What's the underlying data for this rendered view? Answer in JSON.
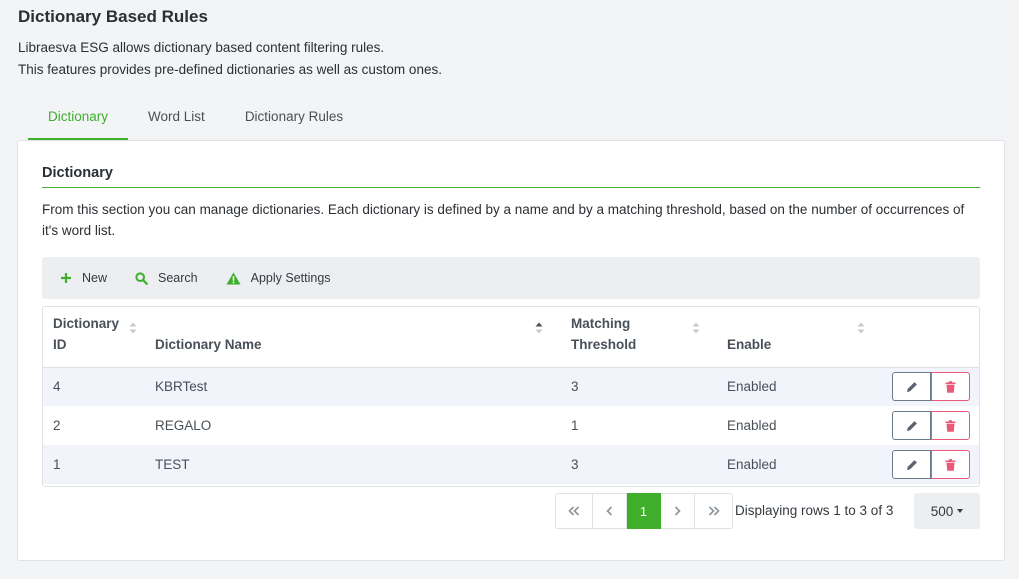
{
  "page": {
    "title": "Dictionary Based Rules",
    "description_line1": "Libraesva ESG allows dictionary based content filtering rules.",
    "description_line2": "This features provides pre-defined dictionaries as well as custom ones."
  },
  "tabs": [
    {
      "label": "Dictionary",
      "active": true
    },
    {
      "label": "Word List",
      "active": false
    },
    {
      "label": "Dictionary Rules",
      "active": false
    }
  ],
  "card": {
    "title": "Dictionary",
    "description": "From this section you can manage dictionaries. Each dictionary is defined by a name and by a matching threshold, based on the number of occurrences of it's word list."
  },
  "toolbar": {
    "new_label": "New",
    "search_label": "Search",
    "apply_label": "Apply Settings"
  },
  "table": {
    "columns": {
      "id_line1": "Dictionary",
      "id_line2": "ID",
      "name": "Dictionary Name",
      "threshold_line1": "Matching",
      "threshold_line2": "Threshold",
      "enable": "Enable"
    },
    "rows": [
      {
        "id": "4",
        "name": "KBRTest",
        "threshold": "3",
        "enable": "Enabled"
      },
      {
        "id": "2",
        "name": "REGALO",
        "threshold": "1",
        "enable": "Enabled"
      },
      {
        "id": "1",
        "name": "TEST",
        "threshold": "3",
        "enable": "Enabled"
      }
    ]
  },
  "pagination": {
    "current_page": "1",
    "rows_info": "Displaying rows 1 to 3 of 3",
    "page_size": "500"
  },
  "colors": {
    "accent": "#3eae2b",
    "danger": "#e85a78",
    "stripe": "#f1f4fa"
  }
}
